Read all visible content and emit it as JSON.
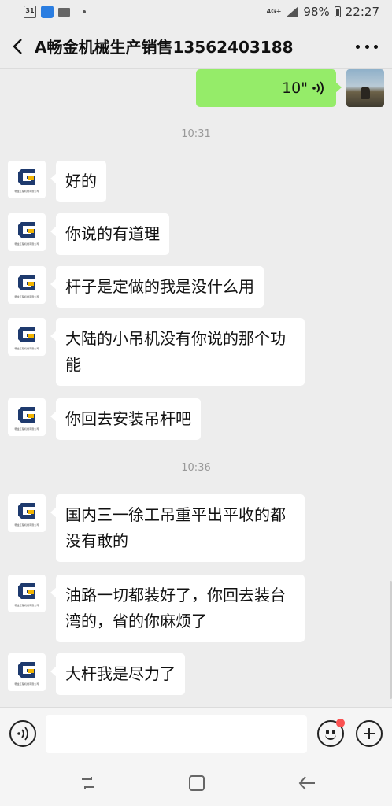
{
  "status_bar": {
    "calendar_day": "31",
    "network": "4G+",
    "battery": "98%",
    "time": "22:27"
  },
  "header": {
    "title": "A畅金机械生产销售13562403188"
  },
  "outgoing_voice": {
    "duration": "10\""
  },
  "colors": {
    "outgoing_bubble": "#95ec69",
    "incoming_bubble": "#ffffff",
    "background": "#ededed",
    "logo_blue": "#1e3a6e",
    "logo_yellow": "#f2b400"
  },
  "timestamps": [
    "10:31",
    "10:36"
  ],
  "messages": [
    {
      "text": "好的"
    },
    {
      "text": "你说的有道理"
    },
    {
      "text": "杆子是定做的我是没什么用"
    },
    {
      "text": "大陆的小吊机没有你说的那个功能"
    },
    {
      "text": "你回去安装吊杆吧"
    },
    {
      "text": "国内三一徐工吊重平出平收的都没有敢的"
    },
    {
      "text": "油路一切都装好了，你回去装台湾的，省的你麻烦了"
    },
    {
      "text": "大杆我是尽力了"
    }
  ],
  "avatar": {
    "caption": "畅金工程机械有限公司"
  },
  "input": {
    "value": "",
    "placeholder": ""
  }
}
